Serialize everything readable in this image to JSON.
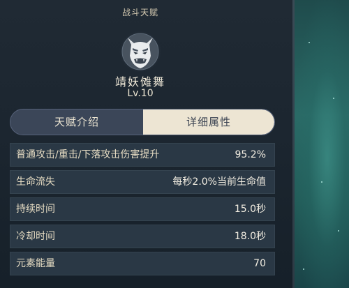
{
  "header": {
    "title": "战斗天赋"
  },
  "talent": {
    "name": "靖妖傩舞",
    "level": "Lv.10"
  },
  "tabs": [
    {
      "label": "天赋介绍",
      "active": false
    },
    {
      "label": "详细属性",
      "active": true
    }
  ],
  "attributes": [
    {
      "label": "普通攻击/重击/下落攻击伤害提升",
      "value": "95.2%"
    },
    {
      "label": "生命流失",
      "value": "每秒2.0%当前生命值"
    },
    {
      "label": "持续时间",
      "value": "15.0秒"
    },
    {
      "label": "冷却时间",
      "value": "18.0秒"
    },
    {
      "label": "元素能量",
      "value": "70"
    }
  ],
  "colors": {
    "panel_bg": "#1c2630",
    "row_bg": "#2a3845",
    "tab_active_bg": "#ede5d3",
    "tab_inactive_bg": "#3b4658",
    "label_text": "#e6dcc3",
    "side_teal": "#2a6a66"
  },
  "icons": {
    "emblem": "oni-mask-icon"
  }
}
